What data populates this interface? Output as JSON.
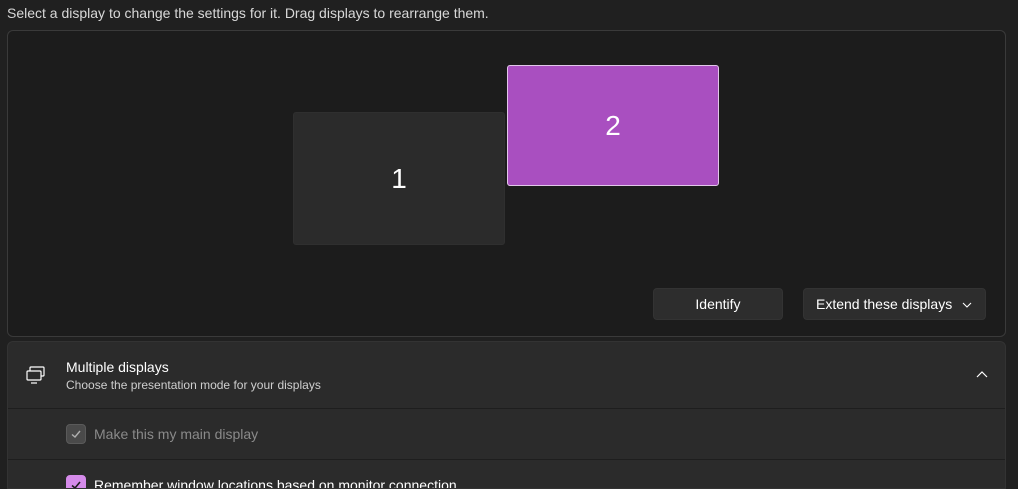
{
  "instructions": "Select a display to change the settings for it. Drag displays to rearrange them.",
  "displays": [
    {
      "label": "1",
      "selected": false,
      "color": "#2b2b2b"
    },
    {
      "label": "2",
      "selected": true,
      "color": "#a94fc0"
    }
  ],
  "buttons": {
    "identify": "Identify",
    "mode_dropdown": {
      "value": "Extend these displays",
      "icon": "chevron-down-icon"
    }
  },
  "multiple_displays": {
    "icon": "multiple-displays-icon",
    "title": "Multiple displays",
    "subtitle": "Choose the presentation mode for your displays",
    "expanded": true,
    "options": [
      {
        "label": "Make this my main display",
        "checked": true,
        "enabled": false
      },
      {
        "label": "Remember window locations based on monitor connection",
        "checked": true,
        "enabled": true
      }
    ]
  },
  "colors": {
    "accent": "#d58bea",
    "selected_display": "#a94fc0",
    "background": "#202020"
  }
}
